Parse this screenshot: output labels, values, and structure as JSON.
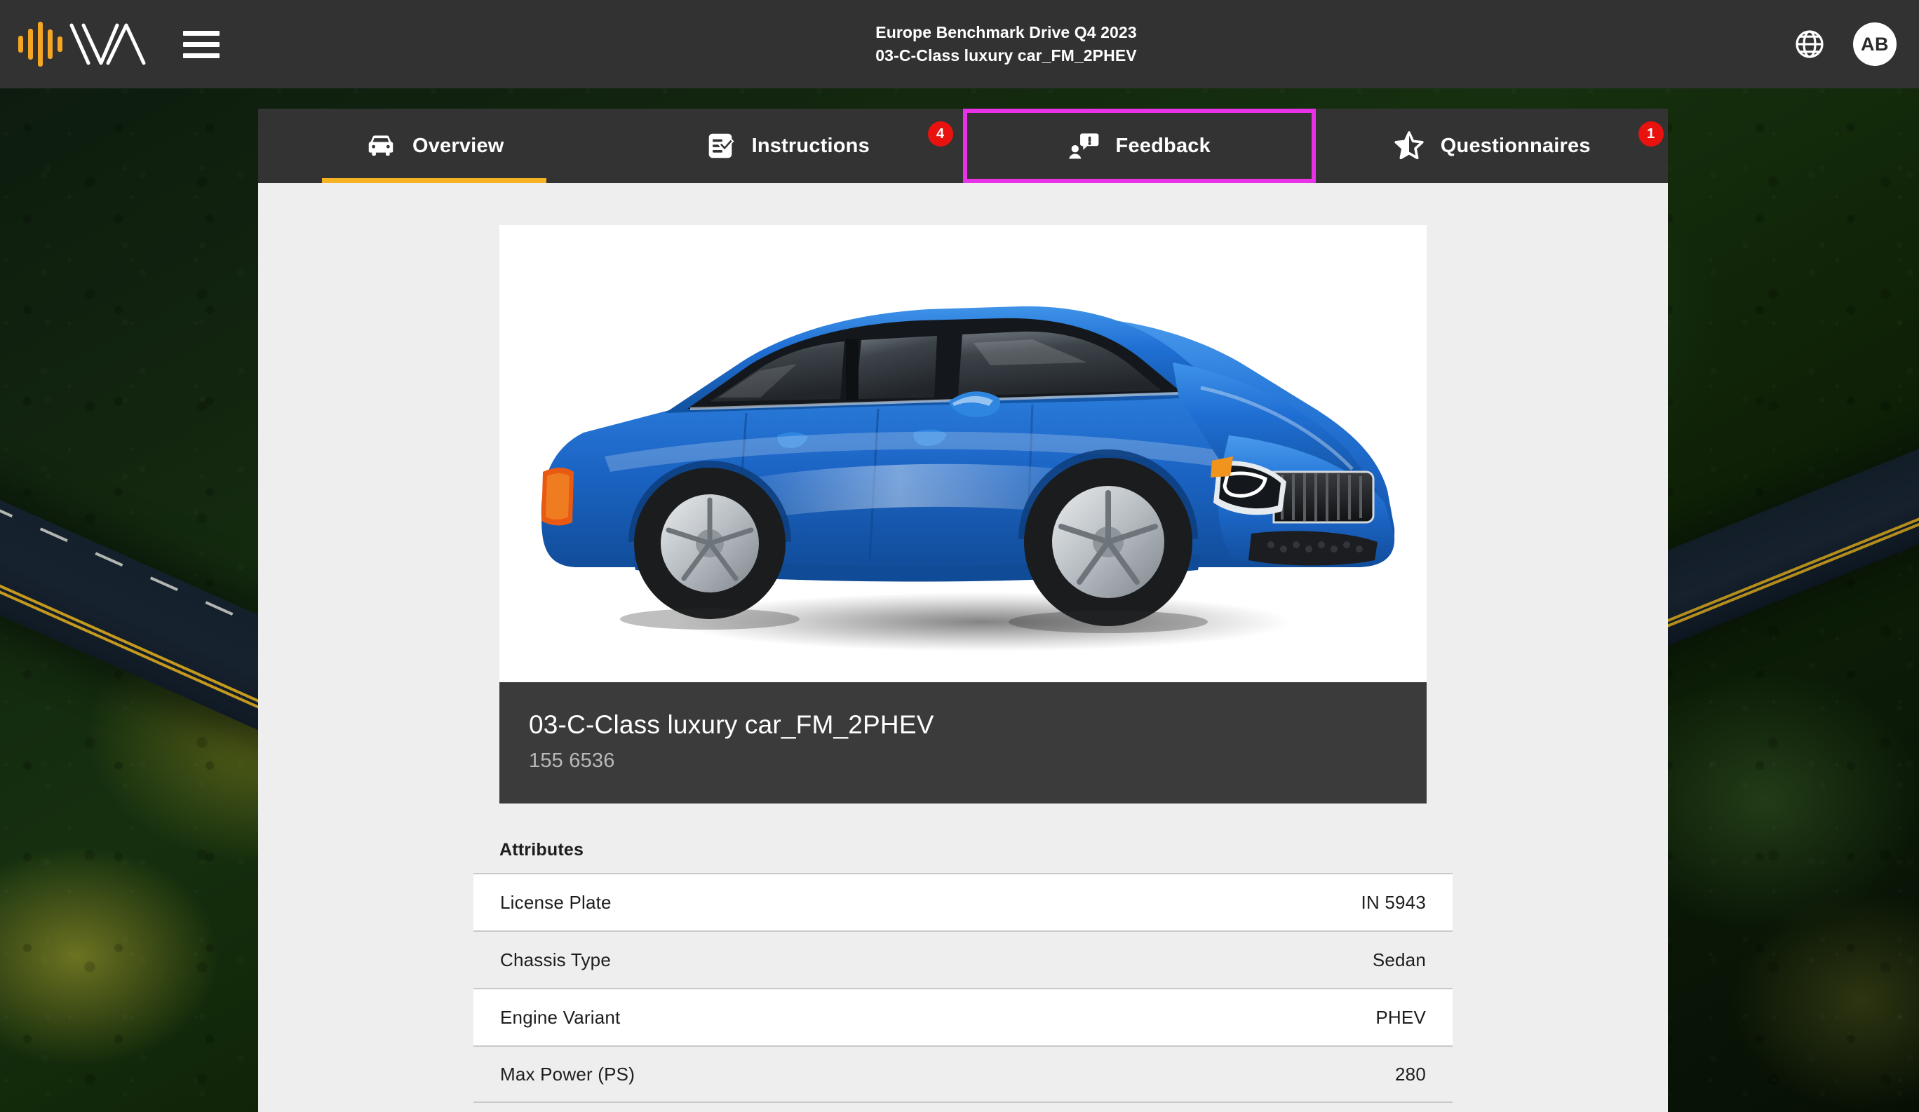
{
  "topbar": {
    "logo_name": "wva-logo",
    "menu_label": "Menu",
    "title_line1": "Europe Benchmark Drive Q4 2023",
    "title_line2": "03-C-Class luxury car_FM_2PHEV",
    "language_icon": "globe-icon",
    "avatar_initials": "AB"
  },
  "tabs": [
    {
      "label": "Overview",
      "icon": "car-front-icon",
      "badge": null,
      "active": true,
      "highlighted": false
    },
    {
      "label": "Instructions",
      "icon": "checklist-icon",
      "badge": "4",
      "active": false,
      "highlighted": false
    },
    {
      "label": "Feedback",
      "icon": "person-comment-icon",
      "badge": null,
      "active": false,
      "highlighted": true
    },
    {
      "label": "Questionnaires",
      "icon": "star-half-icon",
      "badge": "1",
      "active": false,
      "highlighted": false
    }
  ],
  "vehicle": {
    "image_alt": "blue-sedan-car",
    "name": "03-C-Class luxury car_FM_2PHEV",
    "id": "155 6536"
  },
  "attributes": {
    "heading": "Attributes",
    "rows": [
      {
        "key": "License Plate",
        "value": "IN 5943"
      },
      {
        "key": "Chassis Type",
        "value": "Sedan"
      },
      {
        "key": "Engine Variant",
        "value": "PHEV"
      },
      {
        "key": "Max Power (PS)",
        "value": "280"
      }
    ]
  },
  "colors": {
    "topbar_bg": "#323232",
    "tabbar_bg": "#333333",
    "body_bg": "#eeeeee",
    "accent_underline": "#f5b324",
    "highlight_outline": "#e832e8",
    "badge_red": "#e8130f",
    "logo_amber": "#f5a623",
    "caption_bg": "#3b3b3b",
    "car_blue": "#1f6fd4"
  }
}
